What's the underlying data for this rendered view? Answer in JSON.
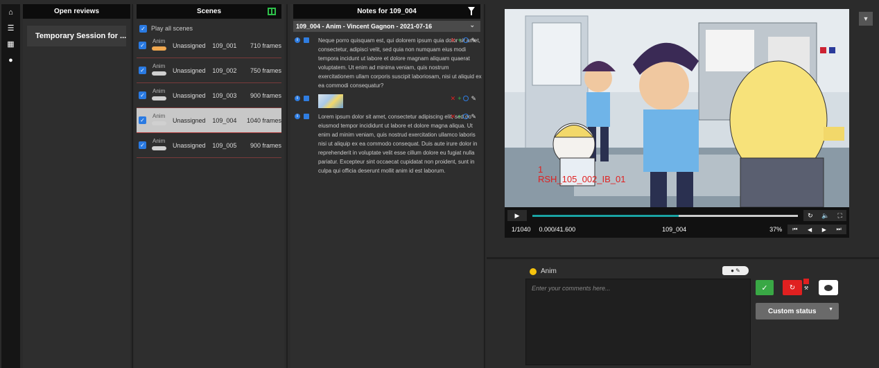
{
  "nav": {
    "items": [
      "home-icon",
      "list-icon",
      "film-icon",
      "comment-icon"
    ]
  },
  "reviews": {
    "header": "Open reviews",
    "session": "Temporary Session for ..."
  },
  "scenes": {
    "header": "Scenes",
    "play_all": "Play all scenes",
    "rows": [
      {
        "task": "Anim",
        "assignee": "Unassigned",
        "name": "109_001",
        "frames": "710 frames",
        "pill_color": "#f0a850",
        "selected": false
      },
      {
        "task": "Anim",
        "assignee": "Unassigned",
        "name": "109_002",
        "frames": "750 frames",
        "pill_color": "#d0d0d0",
        "selected": false
      },
      {
        "task": "Anim",
        "assignee": "Unassigned",
        "name": "109_003",
        "frames": "900 frames",
        "pill_color": "#d0d0d0",
        "selected": false
      },
      {
        "task": "Anim",
        "assignee": "Unassigned",
        "name": "109_004",
        "frames": "1040 frames",
        "pill_color": "#d0d0d0",
        "selected": true
      },
      {
        "task": "Anim",
        "assignee": "Unassigned",
        "name": "109_005",
        "frames": "900 frames",
        "pill_color": "#d0d0d0",
        "selected": false
      }
    ]
  },
  "notes": {
    "header": "Notes for 109_004",
    "task_header": "109_004 - Anim - Vincent Gagnon - 2021-07-16",
    "items": [
      {
        "text": "Neque porro quisquam est, qui dolorem ipsum quia dolor sit amet, consectetur, adipisci velit, sed quia non numquam eius modi tempora incidunt ut labore et dolore magnam aliquam quaerat voluptatem. Ut enim ad minima veniam, quis nostrum exercitationem ullam corporis suscipit laboriosam, nisi ut aliquid ex ea commodi consequatur?"
      },
      {
        "text": ""
      },
      {
        "text": "Lorem ipsum dolor sit amet, consectetur adipiscing elit, sed do eiusmod tempor incididunt ut labore et dolore magna aliqua. Ut enim ad minim veniam, quis nostrud exercitation ullamco laboris nisi ut aliquip ex ea commodo consequat. Duis aute irure dolor in reprehenderit in voluptate velit esse cillum dolore eu fugiat nulla pariatur. Excepteur sint occaecat cupidatat non proident, sunt in culpa qui officia deserunt mollit anim id est laborum."
      }
    ]
  },
  "player": {
    "overlay_num": "1",
    "overlay_text": "RSH_105_002_IB_01",
    "frame": "1/1040",
    "timecode": "0.000/41.600",
    "scene": "109_004",
    "zoom": "37%",
    "progress_fraction": 0.55
  },
  "comment": {
    "task": "Anim",
    "placeholder": "Enter your comments here...",
    "custom_status": "Custom status"
  },
  "colors": {
    "accent_blue": "#2a7ae2",
    "approve_green": "#39a845",
    "retake_red": "#e02020",
    "task_dot": "#f4c20d"
  }
}
